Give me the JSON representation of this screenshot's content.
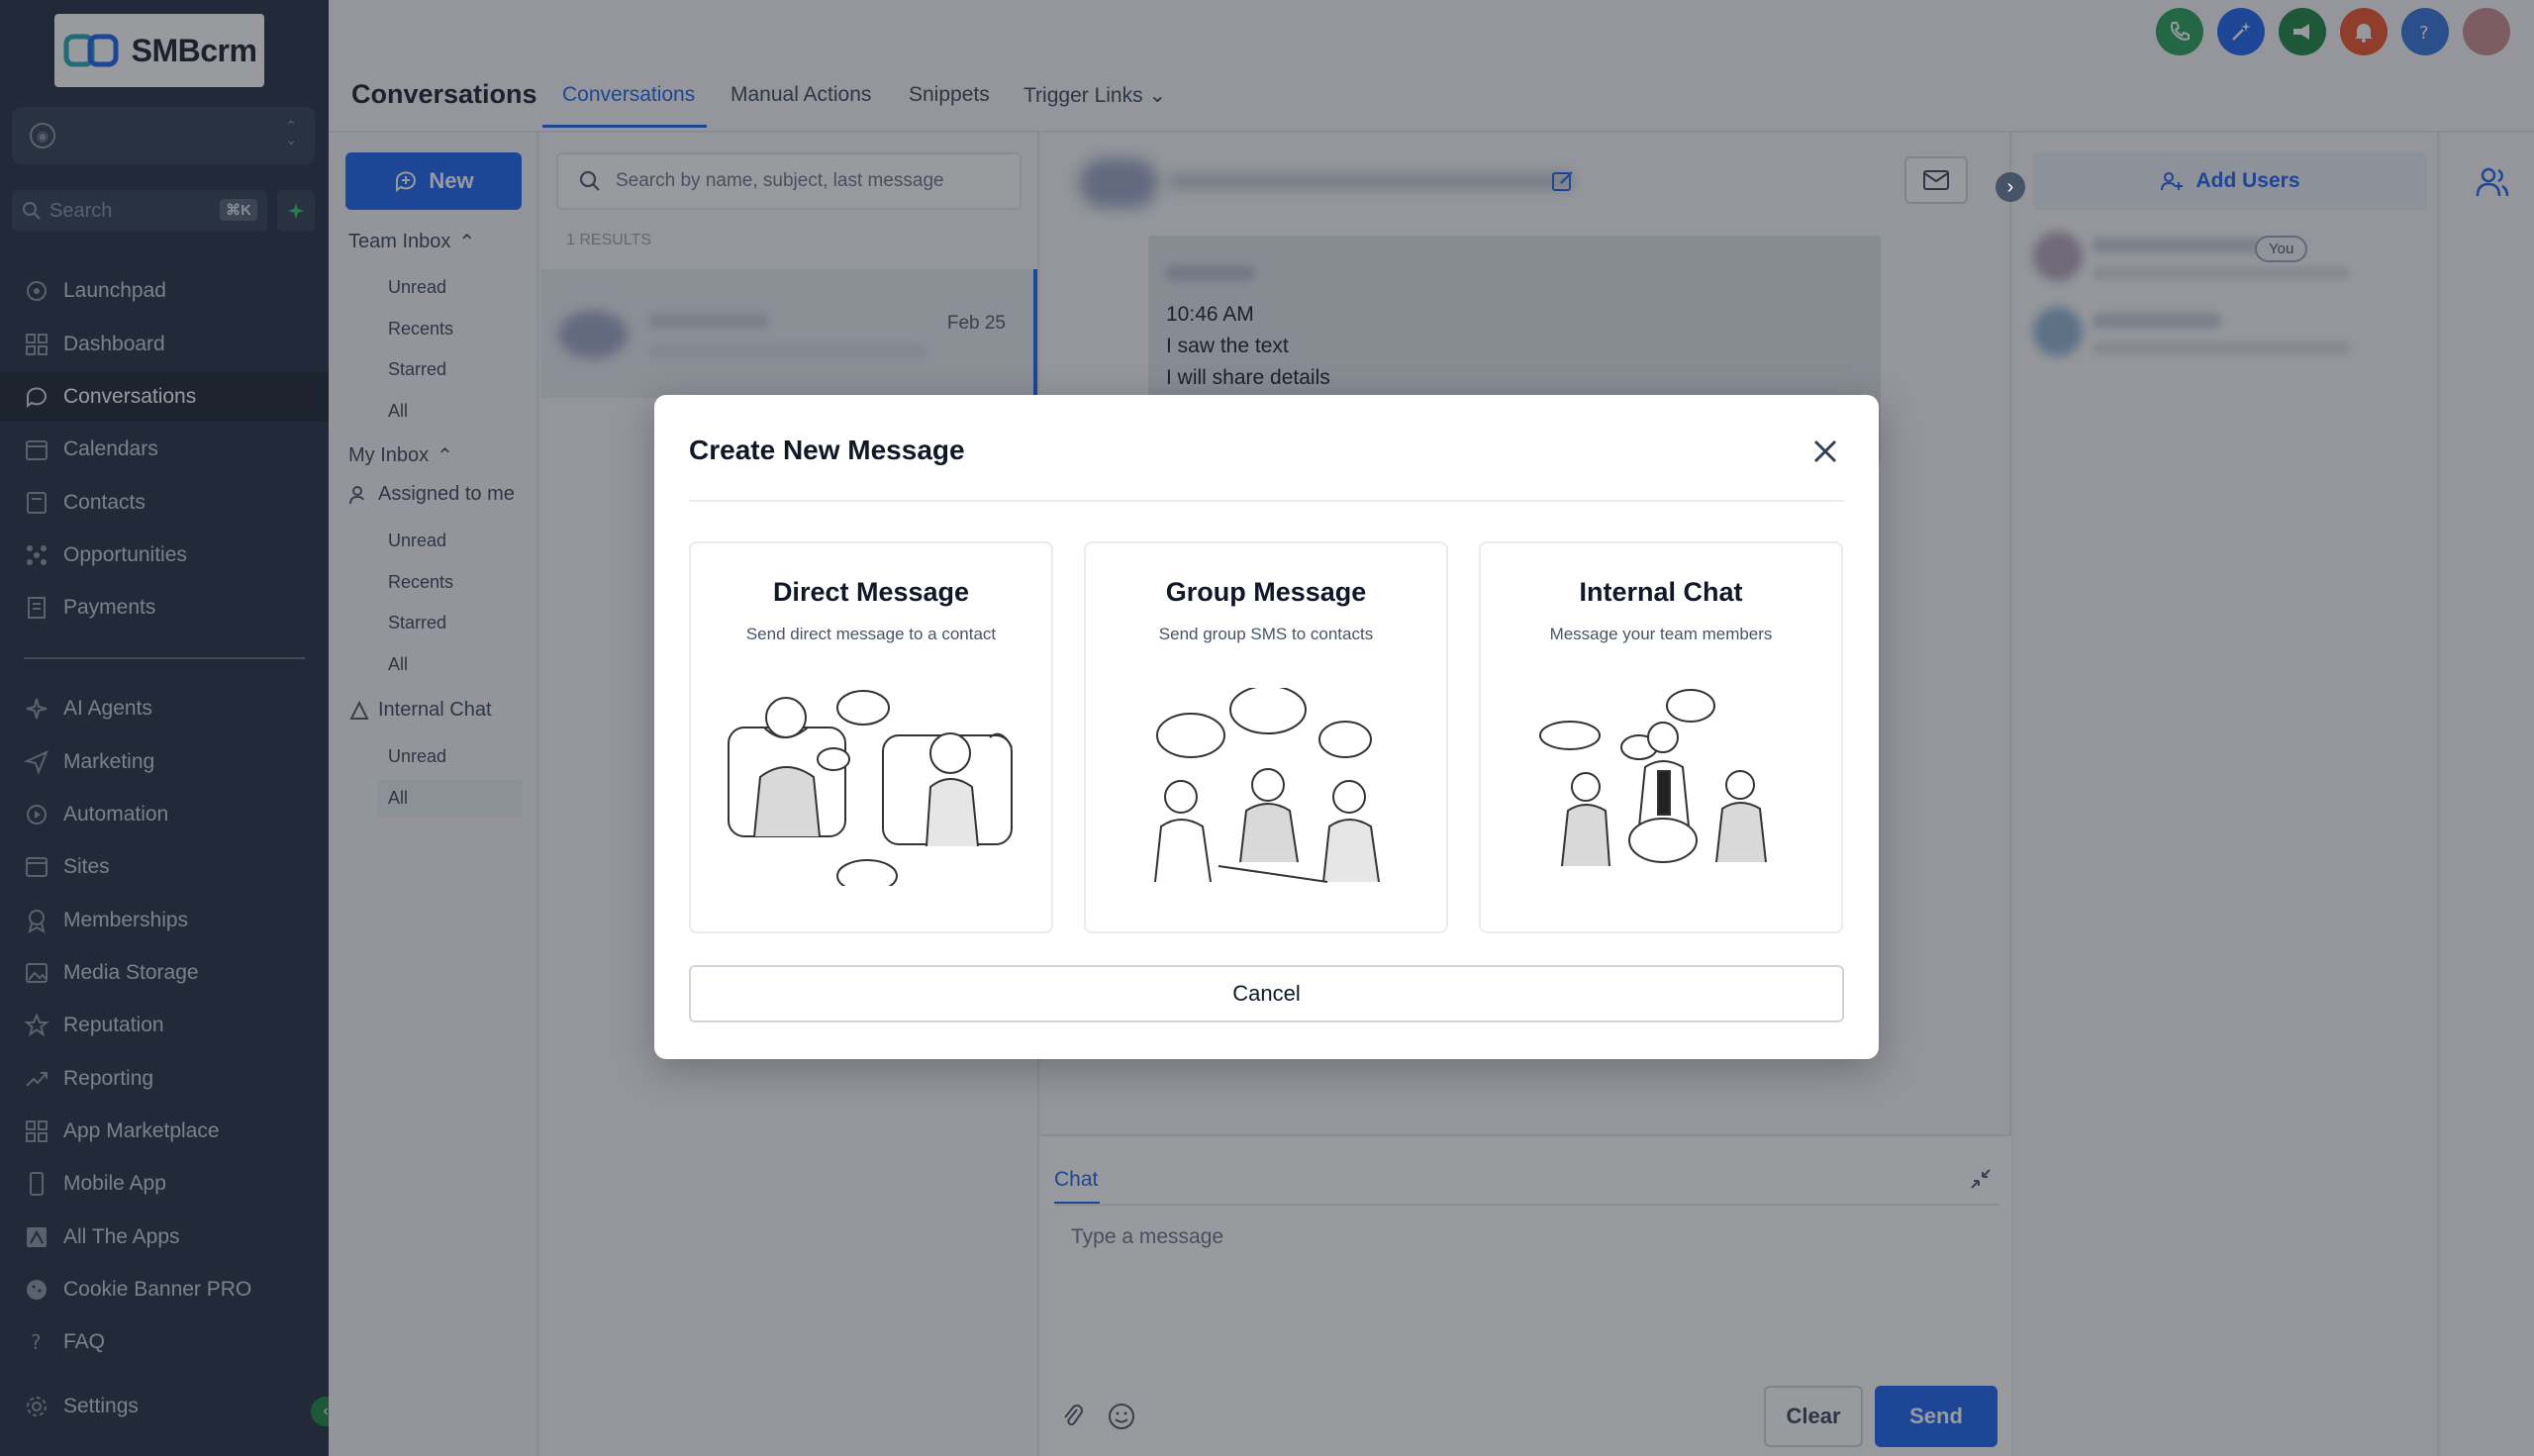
{
  "brand": {
    "name": "SMBcrm"
  },
  "sidebar": {
    "search_placeholder": "Search",
    "search_shortcut": "⌘K",
    "items": [
      {
        "label": "Launchpad",
        "icon": "rocket-icon"
      },
      {
        "label": "Dashboard",
        "icon": "grid-icon"
      },
      {
        "label": "Conversations",
        "icon": "chat-icon",
        "active": true
      },
      {
        "label": "Calendars",
        "icon": "calendar-icon"
      },
      {
        "label": "Contacts",
        "icon": "contacts-icon"
      },
      {
        "label": "Opportunities",
        "icon": "opportunities-icon"
      },
      {
        "label": "Payments",
        "icon": "payments-icon"
      },
      {
        "label": "AI Agents",
        "icon": "sparkle-icon"
      },
      {
        "label": "Marketing",
        "icon": "send-icon"
      },
      {
        "label": "Automation",
        "icon": "automation-icon"
      },
      {
        "label": "Sites",
        "icon": "sites-icon"
      },
      {
        "label": "Memberships",
        "icon": "membership-icon"
      },
      {
        "label": "Media Storage",
        "icon": "image-icon"
      },
      {
        "label": "Reputation",
        "icon": "star-icon"
      },
      {
        "label": "Reporting",
        "icon": "trend-icon"
      },
      {
        "label": "App Marketplace",
        "icon": "apps-icon"
      },
      {
        "label": "Mobile App",
        "icon": "mobile-icon"
      },
      {
        "label": "All The Apps",
        "icon": "all-apps-icon"
      },
      {
        "label": "Cookie Banner PRO",
        "icon": "cookie-icon"
      },
      {
        "label": "FAQ",
        "icon": "question-icon"
      },
      {
        "label": "Settings",
        "icon": "gear-icon"
      }
    ]
  },
  "header": {
    "title": "Conversations",
    "tabs": [
      {
        "label": "Conversations",
        "active": true
      },
      {
        "label": "Manual Actions"
      },
      {
        "label": "Snippets"
      },
      {
        "label": "Trigger Links"
      }
    ],
    "action_colors": {
      "phone": "#1f9d55",
      "ai": "#155eef",
      "announce": "#15803d",
      "notify": "#f04e23",
      "help": "#2e6fd8"
    }
  },
  "inbox": {
    "new_label": "New",
    "team_inbox": "Team Inbox",
    "team_items": [
      "Unread",
      "Recents",
      "Starred",
      "All"
    ],
    "my_inbox": "My Inbox",
    "assigned": "Assigned to me",
    "my_items": [
      "Unread",
      "Recents",
      "Starred",
      "All"
    ],
    "internal_chat": "Internal Chat",
    "internal_items": [
      "Unread",
      "All"
    ]
  },
  "list": {
    "search_placeholder": "Search by name, subject, last message",
    "results": "1 RESULTS",
    "conversation": {
      "date": "Feb 25"
    }
  },
  "chat": {
    "messages": [
      "10:46 AM",
      "I saw the text",
      "I will share details"
    ],
    "composer_tab": "Chat",
    "placeholder": "Type a message",
    "clear_label": "Clear",
    "send_label": "Send"
  },
  "users": {
    "add_label": "Add Users",
    "you_badge": "You"
  },
  "modal": {
    "title": "Create New Message",
    "options": [
      {
        "title": "Direct Message",
        "subtitle": "Send direct message to a contact",
        "icon": "direct-message-illustration"
      },
      {
        "title": "Group Message",
        "subtitle": "Send group SMS to contacts",
        "icon": "group-message-illustration"
      },
      {
        "title": "Internal Chat",
        "subtitle": "Message your team members",
        "icon": "internal-chat-illustration"
      }
    ],
    "cancel_label": "Cancel"
  },
  "colors": {
    "accent": "#155eef",
    "sidebar_bg": "#1e2a3e"
  }
}
